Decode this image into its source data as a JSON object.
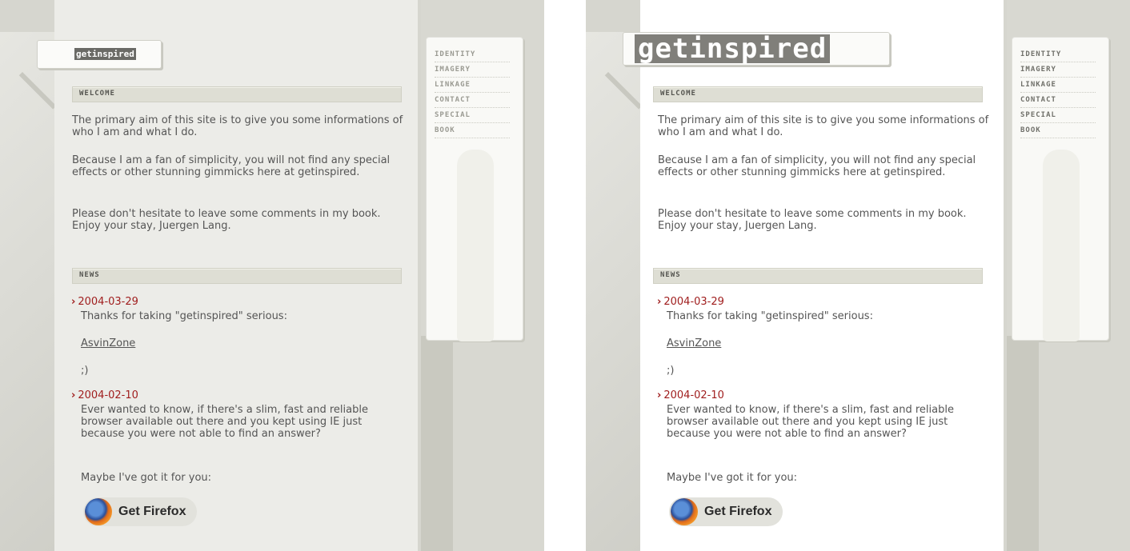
{
  "site": {
    "logo_text": "getinspired"
  },
  "menu": {
    "items": [
      {
        "label": "IDENTITY"
      },
      {
        "label": "IMAGERY"
      },
      {
        "label": "LINKAGE"
      },
      {
        "label": "CONTACT"
      },
      {
        "label": "SPECIAL"
      },
      {
        "label": "BOOK"
      }
    ]
  },
  "welcome": {
    "header": "WELCOME",
    "paragraph_1": "The primary aim of this site is to give you some informations of who I am and what I do.",
    "paragraph_2": "Because I am a fan of simplicity, you will not find any special effects or other stunning gimmicks here at getinspired.",
    "paragraph_3": "Please don't hesitate to leave some comments in my book. Enjoy your stay, Juergen Lang."
  },
  "news": {
    "header": "NEWS",
    "items": [
      {
        "date": "2004-03-29",
        "text": "Thanks for taking \"getinspired\" serious:",
        "link": "AsvinZone",
        "extra": ";)"
      },
      {
        "date": "2004-02-10",
        "text": "Ever wanted to know, if there's a slim, fast and reliable browser available out there and you kept using IE just because you were not able to find an answer?",
        "extra": "Maybe I've got it for you:"
      }
    ]
  },
  "firefox_button": {
    "label": "Get Firefox"
  }
}
